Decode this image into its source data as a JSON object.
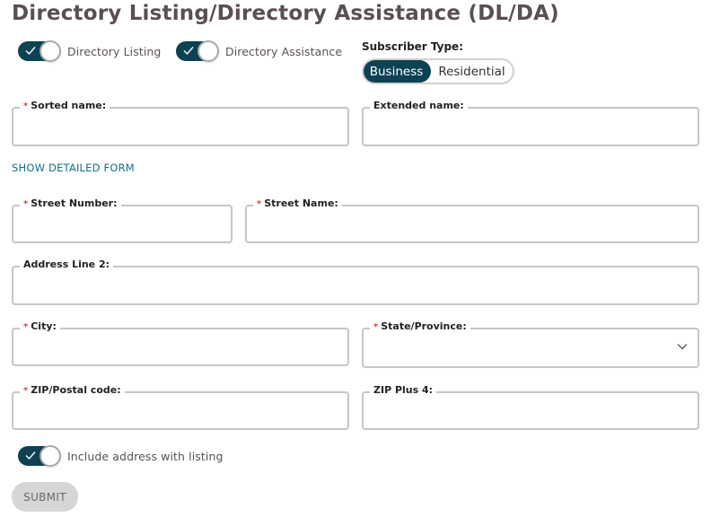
{
  "page": {
    "title": "Directory Listing/Directory Assistance (DL/DA)"
  },
  "toggles": {
    "directory_listing": {
      "label": "Directory Listing",
      "checked": true,
      "icon": "check-icon"
    },
    "directory_assistance": {
      "label": "Directory Assistance",
      "checked": true,
      "icon": "check-icon"
    },
    "include_address": {
      "label": "Include address with listing",
      "checked": true,
      "icon": "check-icon"
    }
  },
  "subscriber_type": {
    "label": "Subscriber Type:",
    "options": [
      "Business",
      "Residential"
    ],
    "selected": "Business"
  },
  "colors": {
    "accent": "#0d4252",
    "link": "#0f6f8a",
    "required": "#e0463a",
    "border": "#c6c6c6",
    "submit_disabled_bg": "#d6d6d6"
  },
  "fields": {
    "sorted_name": {
      "label": "Sorted name:",
      "required": true,
      "value": "",
      "placeholder": ""
    },
    "extended_name": {
      "label": "Extended name:",
      "required": false,
      "value": "",
      "placeholder": ""
    },
    "street_number": {
      "label": "Street Number:",
      "required": true,
      "value": "",
      "placeholder": ""
    },
    "street_name": {
      "label": "Street Name:",
      "required": true,
      "value": "",
      "placeholder": ""
    },
    "address_line_2": {
      "label": "Address Line 2:",
      "required": false,
      "value": "",
      "placeholder": ""
    },
    "city": {
      "label": "City:",
      "required": true,
      "value": "",
      "placeholder": ""
    },
    "state_province": {
      "label": "State/Province:",
      "required": true,
      "value": "",
      "icon": "chevron-down-icon"
    },
    "zip_postal": {
      "label": "ZIP/Postal code:",
      "required": true,
      "value": "",
      "placeholder": ""
    },
    "zip_plus_4": {
      "label": "ZIP Plus 4:",
      "required": false,
      "value": "",
      "placeholder": ""
    }
  },
  "required_marker": "*",
  "links": {
    "show_detailed_form": "SHOW DETAILED FORM"
  },
  "buttons": {
    "submit": "SUBMIT"
  }
}
